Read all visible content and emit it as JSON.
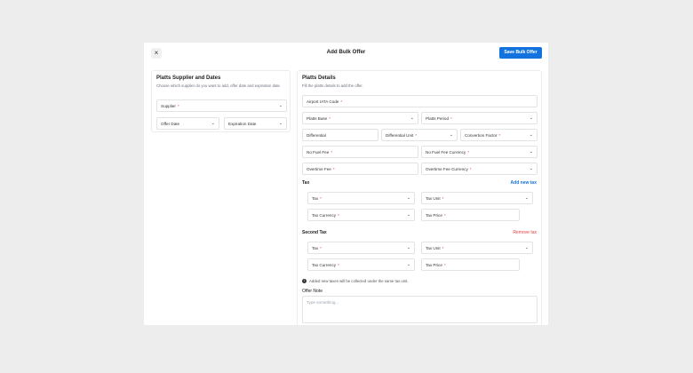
{
  "header": {
    "close_label": "×",
    "title": "Add Bulk Offer",
    "save_label": "Save Bulk Offer"
  },
  "left": {
    "title": "Platts Supplier and Dates",
    "subtitle": "Choose which supplier do you want to add, offer date and expiration date",
    "supplier": "Supplier",
    "offer_date": "Offer Date",
    "expiration_date": "Expiration Date"
  },
  "right": {
    "title": "Platts Details",
    "subtitle": "Fill the platts details to add the offer.",
    "airport": "Airport IATA Code",
    "platts_base": "Platts Base",
    "platts_period": "Platts Period",
    "differential": "Differential",
    "differential_unit": "Differential Unit",
    "conversion_factor": "Convertion Factor",
    "no_fuel_fee": "No Fuel Fee",
    "no_fuel_fee_currency": "No Fuel Fee Currency",
    "overtime_fee": "Overtime Fee",
    "overtime_fee_currency": "Overtime Fee Currency",
    "tax_section": "Tax",
    "add_tax": "Add new tax",
    "second_tax_section": "Second Tax",
    "remove_tax": "Remove tax",
    "tax": "Tax",
    "tax_unit": "Tax Unit",
    "tax_currency": "Tax Currency",
    "tax_price": "Tax Price",
    "note": "Added new taxes will be collected under the same tax unit.",
    "offer_note_label": "Offer Note",
    "offer_note_placeholder": "Type something..."
  },
  "symbols": {
    "required": "*",
    "chevron": "⌄",
    "info": "i"
  }
}
